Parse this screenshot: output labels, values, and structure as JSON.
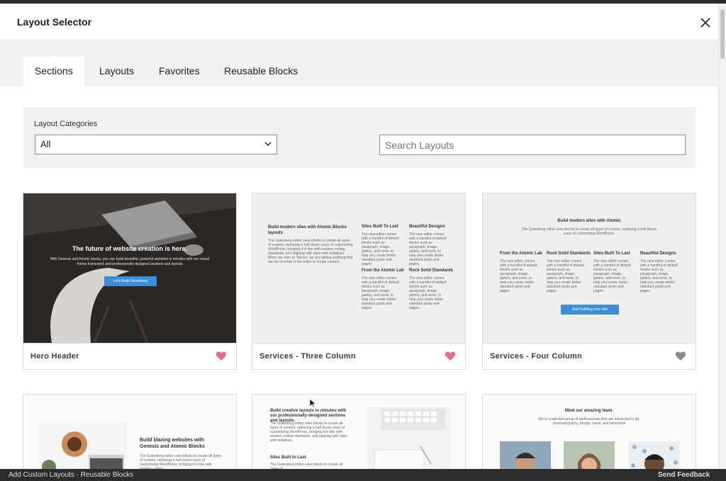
{
  "modal": {
    "title": "Layout Selector",
    "close_icon": "close-icon"
  },
  "tabs": [
    {
      "label": "Sections",
      "active": true
    },
    {
      "label": "Layouts",
      "active": false
    },
    {
      "label": "Favorites",
      "active": false
    },
    {
      "label": "Reusable Blocks",
      "active": false
    }
  ],
  "filters": {
    "category_label": "Layout Categories",
    "category_value": "All",
    "search_placeholder": "Search Layouts"
  },
  "cards": [
    {
      "name": "Hero Header",
      "favorite": true,
      "preview": {
        "heading": "The future of website creation is here.",
        "text": "With Genesis and Atomic blocks, you can build beautiful, powerful websites in minutes with our robust theme framework and professionally-designed sections and layouts",
        "button": "Let's Build Something"
      }
    },
    {
      "name": "Services - Three Column",
      "favorite": true,
      "preview": {
        "heading": "Build modern sites with Atomic Blocks layouts",
        "intro": "The Gutenberg editor uses blocks to create all types of content, replacing a half dozen ways of customizing WordPress, bringing it in line with modern coding standards, and aligning with open web initiatives. When we refer to \"blocks\" we are talking anything that can be inserted in the editor to create content.",
        "col_titles": [
          "Sites Built To Last",
          "Beautiful Designs",
          "From the Atomic Lab",
          "Rock Solid Standards"
        ],
        "col_text": "The new editor comes with a handful of default blocks such as paragraph, image, gallery, and more, to help you create better standard posts and pages."
      }
    },
    {
      "name": "Services - Four Column",
      "favorite": false,
      "preview": {
        "heading": "Build modern sites with Atomic",
        "intro": "The Gutenberg editor uses blocks to create all types of content, replacing a half dozen ways of customizing WordPress.",
        "col_titles": [
          "From the Atomic Lab",
          "Rock Solid Standards",
          "Sites Built To Last",
          "Beautiful Designs"
        ],
        "col_text": "The new editor comes with a handful of default blocks such as paragraph, image, gallery, and more, to help you create better standard posts and pages.",
        "button": "Start building your site!"
      }
    }
  ],
  "row2": [
    {
      "heading": "Build blazing websites with Genesis and Atomic Blocks",
      "text": "The Gutenberg editor uses blocks to create all types of content, replacing a half dozen ways of customizing WordPress, bringing it in line with modern coding"
    },
    {
      "heading": "Build creative layouts in minutes with our professionally-designed sections and layouts.",
      "text": "The Gutenberg editor uses blocks to create all types of content, replacing a half dozen ways of customizing WordPress, bringing it in line with modern coding standards, and aligning with open web initiatives.",
      "sub": "Sites Built to Last",
      "subtext": "The Gutenberg editor uses blocks to create all types of"
    },
    {
      "heading": "Meet our amazing team.",
      "text": "We're a talented group of professionals who are interested in art, cinematography, design, travel, and adventure"
    }
  ],
  "bottom_bar": {
    "left": "Add Custom Layouts · Reusable Blocks",
    "right": "Send Feedback"
  },
  "colors": {
    "heart_active": "#e9679a",
    "heart_inactive": "#8a8a8a",
    "accent_blue": "#3b8ed8"
  }
}
